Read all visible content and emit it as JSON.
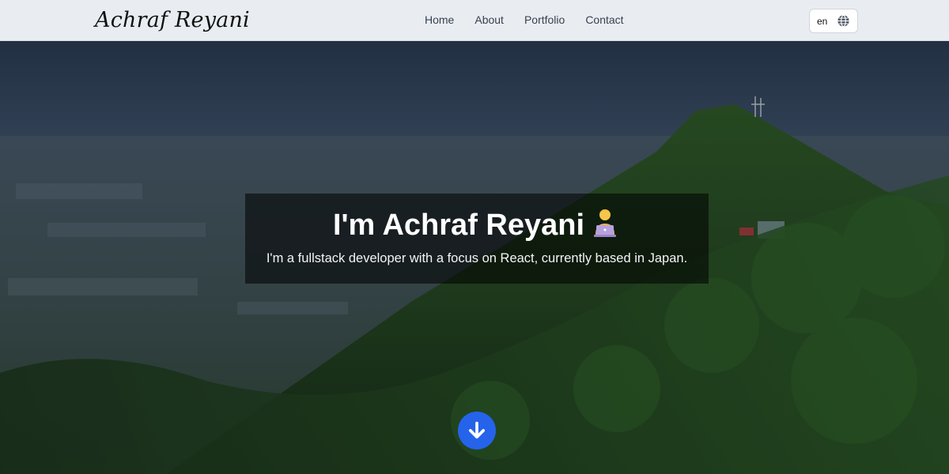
{
  "header": {
    "logo": "Achraf Reyani",
    "nav": [
      "Home",
      "About",
      "Portfolio",
      "Contact"
    ],
    "language": {
      "code": "en",
      "icon": "globe-icon"
    }
  },
  "hero": {
    "title": "I'm Achraf Reyani",
    "title_emoji": "technologist-emoji",
    "subtitle": "I'm a fullstack developer with a focus on React, currently based in Japan.",
    "scroll_icon": "arrow-down-icon",
    "background": "mountain-landscape-photo"
  },
  "colors": {
    "header_bg": "#e9edf1",
    "accent": "#2563eb",
    "text_dark": "#111111",
    "nav_text": "#374151"
  }
}
